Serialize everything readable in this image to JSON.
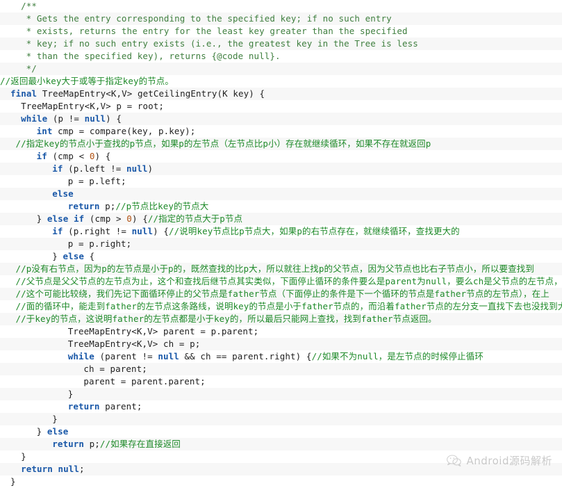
{
  "editor": {
    "language": "java",
    "background": "#ffffff",
    "stripe_background": "#f7f7f7",
    "keyword_color": "#1a58a8",
    "comment_color": "#3f7f3f",
    "chinese_comment_color": "#1e8a29",
    "number_color": "#b05010",
    "text_color": "#1f1f1f"
  },
  "watermark": {
    "icon": "wechat-bubble-icon",
    "text": "Android源码解析"
  },
  "lines": [
    {
      "n": 1,
      "indent": 4,
      "segments": [
        {
          "t": "cmt",
          "s": "/**"
        }
      ]
    },
    {
      "n": 2,
      "indent": 5,
      "segments": [
        {
          "t": "cmt",
          "s": "* Gets the entry corresponding to the specified key; if no such entry"
        }
      ]
    },
    {
      "n": 3,
      "indent": 5,
      "segments": [
        {
          "t": "cmt",
          "s": "* exists, returns the entry for the least key greater than the specified"
        }
      ]
    },
    {
      "n": 4,
      "indent": 5,
      "segments": [
        {
          "t": "cmt",
          "s": "* key; if no such entry exists (i.e., the greatest key in the Tree is less"
        }
      ]
    },
    {
      "n": 5,
      "indent": 5,
      "segments": [
        {
          "t": "cmt",
          "s": "* than the specified key), returns {@code null}."
        }
      ]
    },
    {
      "n": 6,
      "indent": 5,
      "segments": [
        {
          "t": "cmt",
          "s": "*/"
        }
      ]
    },
    {
      "n": 7,
      "indent": 0,
      "segments": [
        {
          "t": "cmt-cn",
          "s": "//返回最小key大于或等于指定key的节点。"
        }
      ]
    },
    {
      "n": 8,
      "indent": 2,
      "segments": [
        {
          "t": "kw",
          "s": "final"
        },
        {
          "t": "plain",
          "s": " TreeMapEntry<K,V> getCeilingEntry(K key) {"
        }
      ]
    },
    {
      "n": 9,
      "indent": 4,
      "segments": [
        {
          "t": "plain",
          "s": "TreeMapEntry<K,V> p = root;"
        }
      ]
    },
    {
      "n": 10,
      "indent": 4,
      "segments": [
        {
          "t": "kw",
          "s": "while"
        },
        {
          "t": "plain",
          "s": " (p != "
        },
        {
          "t": "kw",
          "s": "null"
        },
        {
          "t": "plain",
          "s": ") {"
        }
      ]
    },
    {
      "n": 11,
      "indent": 7,
      "segments": [
        {
          "t": "kw",
          "s": "int"
        },
        {
          "t": "plain",
          "s": " cmp = compare(key, p.key);"
        }
      ]
    },
    {
      "n": 12,
      "indent": 3,
      "segments": [
        {
          "t": "cmt-cn",
          "s": "//指定key的节点小于查找的p节点，如果p的左节点（左节点比p小）存在就继续循环，如果不存在就返回p"
        }
      ]
    },
    {
      "n": 13,
      "indent": 7,
      "segments": [
        {
          "t": "kw",
          "s": "if"
        },
        {
          "t": "plain",
          "s": " (cmp < "
        },
        {
          "t": "num",
          "s": "0"
        },
        {
          "t": "plain",
          "s": ") {"
        }
      ]
    },
    {
      "n": 14,
      "indent": 10,
      "segments": [
        {
          "t": "kw",
          "s": "if"
        },
        {
          "t": "plain",
          "s": " (p.left != "
        },
        {
          "t": "kw",
          "s": "null"
        },
        {
          "t": "plain",
          "s": ")"
        }
      ]
    },
    {
      "n": 15,
      "indent": 13,
      "segments": [
        {
          "t": "plain",
          "s": "p = p.left;"
        }
      ]
    },
    {
      "n": 16,
      "indent": 10,
      "segments": [
        {
          "t": "kw",
          "s": "else"
        }
      ]
    },
    {
      "n": 17,
      "indent": 13,
      "segments": [
        {
          "t": "kw",
          "s": "return"
        },
        {
          "t": "plain",
          "s": " p;"
        },
        {
          "t": "cmt-cn",
          "s": "//p节点比key的节点大"
        }
      ]
    },
    {
      "n": 18,
      "indent": 7,
      "segments": [
        {
          "t": "plain",
          "s": "} "
        },
        {
          "t": "kw",
          "s": "else if"
        },
        {
          "t": "plain",
          "s": " (cmp > "
        },
        {
          "t": "num",
          "s": "0"
        },
        {
          "t": "plain",
          "s": ") {"
        },
        {
          "t": "cmt-cn",
          "s": "//指定的节点大于p节点"
        }
      ]
    },
    {
      "n": 19,
      "indent": 10,
      "segments": [
        {
          "t": "kw",
          "s": "if"
        },
        {
          "t": "plain",
          "s": " (p.right != "
        },
        {
          "t": "kw",
          "s": "null"
        },
        {
          "t": "plain",
          "s": ") {"
        },
        {
          "t": "cmt-cn",
          "s": "//说明key节点比p节点大，如果p的右节点存在，就继续循环，查找更大的"
        }
      ]
    },
    {
      "n": 20,
      "indent": 13,
      "segments": [
        {
          "t": "plain",
          "s": "p = p.right;"
        }
      ]
    },
    {
      "n": 21,
      "indent": 10,
      "segments": [
        {
          "t": "plain",
          "s": "} "
        },
        {
          "t": "kw",
          "s": "else"
        },
        {
          "t": "plain",
          "s": " {"
        }
      ]
    },
    {
      "n": 22,
      "indent": 3,
      "segments": [
        {
          "t": "cmt-cn",
          "s": "//p没有右节点，因为p的左节点是小于p的，既然查找的比p大，所以就往上找p的父节点，因为父节点也比右子节点小，所以要查找到"
        }
      ]
    },
    {
      "n": 23,
      "indent": 3,
      "segments": [
        {
          "t": "cmt-cn",
          "s": "//父节点是父父节点的左节点为止，这个和查找后继节点其实类似，下面停止循环的条件要么是parent为null，要么ch是父节点的左节点，"
        }
      ]
    },
    {
      "n": 24,
      "indent": 3,
      "segments": [
        {
          "t": "cmt-cn",
          "s": "//这个可能比较绕，我们先记下面循环停止的父节点是father节点（下面停止的条件是下一个循环的节点是father节点的左节点），在上"
        }
      ]
    },
    {
      "n": 25,
      "indent": 3,
      "segments": [
        {
          "t": "cmt-cn",
          "s": "//面的循环中，能走到father的左节点这条路线，说明key的节点是小于father节点的，而沿着father节点的左分支一直找下去也没找到大"
        }
      ]
    },
    {
      "n": 26,
      "indent": 3,
      "segments": [
        {
          "t": "cmt-cn",
          "s": "//于key的节点，这说明father的左节点都是小于key的，所以最后只能网上查找，找到father节点返回。"
        }
      ]
    },
    {
      "n": 27,
      "indent": 13,
      "segments": [
        {
          "t": "plain",
          "s": "TreeMapEntry<K,V> parent = p.parent;"
        }
      ]
    },
    {
      "n": 28,
      "indent": 13,
      "segments": [
        {
          "t": "plain",
          "s": "TreeMapEntry<K,V> ch = p;"
        }
      ]
    },
    {
      "n": 29,
      "indent": 13,
      "segments": [
        {
          "t": "kw",
          "s": "while"
        },
        {
          "t": "plain",
          "s": " (parent != "
        },
        {
          "t": "kw",
          "s": "null"
        },
        {
          "t": "plain",
          "s": " && ch == parent.right) {"
        },
        {
          "t": "cmt-cn",
          "s": "//如果不为null，是左节点的时候停止循环"
        }
      ]
    },
    {
      "n": 30,
      "indent": 16,
      "segments": [
        {
          "t": "plain",
          "s": "ch = parent;"
        }
      ]
    },
    {
      "n": 31,
      "indent": 16,
      "segments": [
        {
          "t": "plain",
          "s": "parent = parent.parent;"
        }
      ]
    },
    {
      "n": 32,
      "indent": 13,
      "segments": [
        {
          "t": "plain",
          "s": "}"
        }
      ]
    },
    {
      "n": 33,
      "indent": 13,
      "segments": [
        {
          "t": "kw",
          "s": "return"
        },
        {
          "t": "plain",
          "s": " parent;"
        }
      ]
    },
    {
      "n": 34,
      "indent": 10,
      "segments": [
        {
          "t": "plain",
          "s": "}"
        }
      ]
    },
    {
      "n": 35,
      "indent": 7,
      "segments": [
        {
          "t": "plain",
          "s": "} "
        },
        {
          "t": "kw",
          "s": "else"
        }
      ]
    },
    {
      "n": 36,
      "indent": 10,
      "segments": [
        {
          "t": "kw",
          "s": "return"
        },
        {
          "t": "plain",
          "s": " p;"
        },
        {
          "t": "cmt-cn",
          "s": "//如果存在直接返回"
        }
      ]
    },
    {
      "n": 37,
      "indent": 4,
      "segments": [
        {
          "t": "plain",
          "s": "}"
        }
      ]
    },
    {
      "n": 38,
      "indent": 4,
      "segments": [
        {
          "t": "kw",
          "s": "return"
        },
        {
          "t": "plain",
          "s": " "
        },
        {
          "t": "kw",
          "s": "null"
        },
        {
          "t": "plain",
          "s": ";"
        }
      ]
    },
    {
      "n": 39,
      "indent": 2,
      "segments": [
        {
          "t": "plain",
          "s": "}"
        }
      ]
    }
  ]
}
